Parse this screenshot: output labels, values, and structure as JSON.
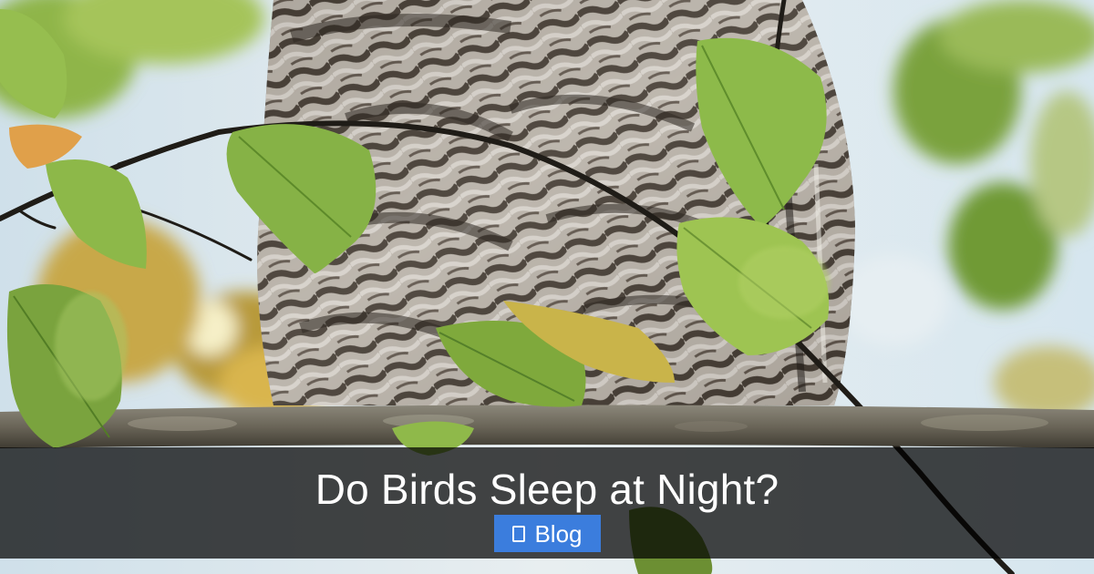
{
  "post": {
    "title": "Do Birds Sleep at Night?",
    "category": {
      "label": "Blog",
      "icon": "folder-icon"
    }
  },
  "image": {
    "subject": "barred-owl-on-branch",
    "colors": {
      "sky": "#dde8ee",
      "foliage": "#7fae3c",
      "owl_dark": "#3a3129",
      "owl_light": "#d9d4cc",
      "branch": "#6e6a5f",
      "badge": "#3b7ddd"
    }
  }
}
